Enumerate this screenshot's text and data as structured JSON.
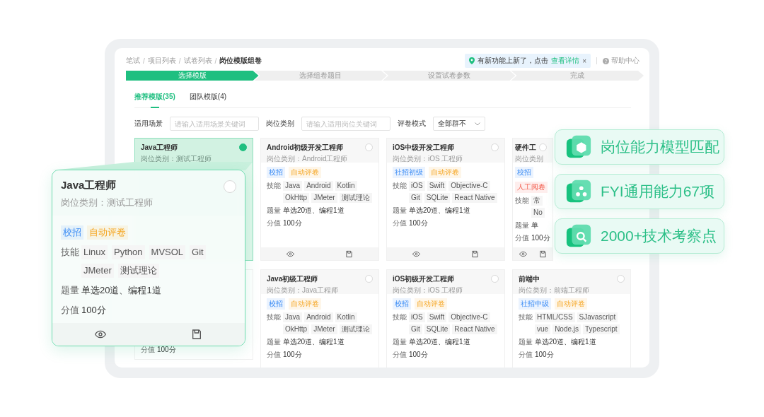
{
  "breadcrumb": [
    {
      "label": "笔试",
      "separator": "/",
      "current": false
    },
    {
      "label": "项目列表",
      "separator": "/",
      "current": false
    },
    {
      "label": "试卷列表",
      "separator": "/",
      "current": false
    },
    {
      "label": "岗位模版组卷",
      "current": true
    }
  ],
  "notice": {
    "text": "有新功能上新了，点击",
    "link": "查看详情",
    "close": "×"
  },
  "help": "帮助中心",
  "steps": [
    {
      "label": "选择模版",
      "selected": true
    },
    {
      "label": "选择组卷题目",
      "selected": false
    },
    {
      "label": "设置试卷参数",
      "selected": false
    },
    {
      "label": "完成",
      "selected": false
    }
  ],
  "tabs": [
    {
      "label": "推荐模版(35)",
      "selected": true
    },
    {
      "label": "团队模版(4)",
      "selected": false
    }
  ],
  "filters": [
    {
      "kind": "input",
      "label": "适用场景",
      "placeholder": "请输入适用场景关键词"
    },
    {
      "kind": "input",
      "label": "岗位类别",
      "placeholder": "请输入适用岗位关键词"
    },
    {
      "kind": "select",
      "label": "评卷模式",
      "value": "全部群不"
    }
  ],
  "cards": [
    {
      "title": "Java工程师",
      "category": "岗位类别：测试工程师",
      "selected": true
    },
    {
      "title": "Android初级开发工程师",
      "category": "岗位类别：Android工程师",
      "selected": false,
      "tags": [
        {
          "text": "校招",
          "kind": "level"
        },
        {
          "text": "自动评卷",
          "kind": "auto"
        }
      ],
      "skills_label": "技能",
      "skills": [
        "Java",
        "Android",
        "Kotlin",
        "OkHttp",
        "JMeter",
        "测试理论"
      ],
      "count_label": "题量",
      "count": "单选20道、编程1道",
      "score_label": "分值",
      "score": "100分"
    },
    {
      "title": "iOS中级开发工程师",
      "category": "岗位类别：iOS 工程师",
      "selected": false,
      "tags": [
        {
          "text": "社招初级",
          "kind": "level"
        },
        {
          "text": "自动评卷",
          "kind": "auto"
        }
      ],
      "skills_label": "技能",
      "skills": [
        "iOS",
        "Swift",
        "Objective-C",
        "Git",
        "SQLite",
        "React Native"
      ],
      "count_label": "题量",
      "count": "单选20道、编程1道",
      "score_label": "分值",
      "score": "100分"
    },
    {
      "title": "硬件工",
      "category": "岗位类别",
      "selected": false,
      "tags": [
        {
          "text": "校招",
          "kind": "level"
        },
        {
          "text": "人工阅卷",
          "kind": "manual"
        }
      ],
      "skills_label": "技能",
      "skills": [
        "常",
        "No"
      ],
      "count_label": "题量",
      "count": "单",
      "score_label": "分值",
      "score": "100分"
    },
    {
      "score_label": "分值",
      "score": "100分"
    },
    {
      "title": "Java初级工程师",
      "category": "岗位类别：Java工程师",
      "selected": false,
      "tags": [
        {
          "text": "校招",
          "kind": "level"
        },
        {
          "text": "自动评卷",
          "kind": "auto"
        }
      ],
      "skills_label": "技能",
      "skills": [
        "Java",
        "Android",
        "Kotlin",
        "OkHttp",
        "JMeter",
        "测试理论"
      ],
      "count_label": "题量",
      "count": "单选20道、编程1道",
      "score_label": "分值",
      "score": "100分"
    },
    {
      "title": "iOS初级开发工程师",
      "category": "岗位类别：iOS 工程师",
      "selected": false,
      "tags": [
        {
          "text": "校招",
          "kind": "level"
        },
        {
          "text": "自动评卷",
          "kind": "auto"
        }
      ],
      "skills_label": "技能",
      "skills": [
        "iOS",
        "Swift",
        "Objective-C",
        "Git",
        "SQLite",
        "React Native"
      ],
      "count_label": "题量",
      "count": "单选20道、编程1道",
      "score_label": "分值",
      "score": "100分"
    },
    {
      "title": "前端中",
      "category": "岗位类别：前端工程师",
      "selected": false,
      "tags": [
        {
          "text": "社招中级",
          "kind": "level"
        },
        {
          "text": "自动评卷",
          "kind": "auto"
        }
      ],
      "skills_label": "技能",
      "skills": [
        "HTML/CSS",
        "SJavascript",
        "vue",
        "Node.js",
        "Typescript"
      ],
      "count_label": "题量",
      "count": "单选20道、编程1道",
      "score_label": "分值",
      "score": "100分"
    }
  ],
  "popup": {
    "title": "Java工程师",
    "category": "岗位类别：测试工程师",
    "selected": false,
    "tags": [
      {
        "text": "校招",
        "kind": "level"
      },
      {
        "text": "自动评卷",
        "kind": "auto"
      }
    ],
    "skills_label": "技能",
    "skills": [
      "Linux",
      "Python",
      "MVSOL",
      "Git",
      "JMeter",
      "测试理论"
    ],
    "count_label": "题量",
    "count": "单选20道、编程1道",
    "score_label": "分值",
    "score": "100分"
  },
  "features": [
    {
      "label": "岗位能力模型匹配"
    },
    {
      "label": "FYI通用能力67项"
    },
    {
      "label": "2000+技术考察点"
    }
  ]
}
